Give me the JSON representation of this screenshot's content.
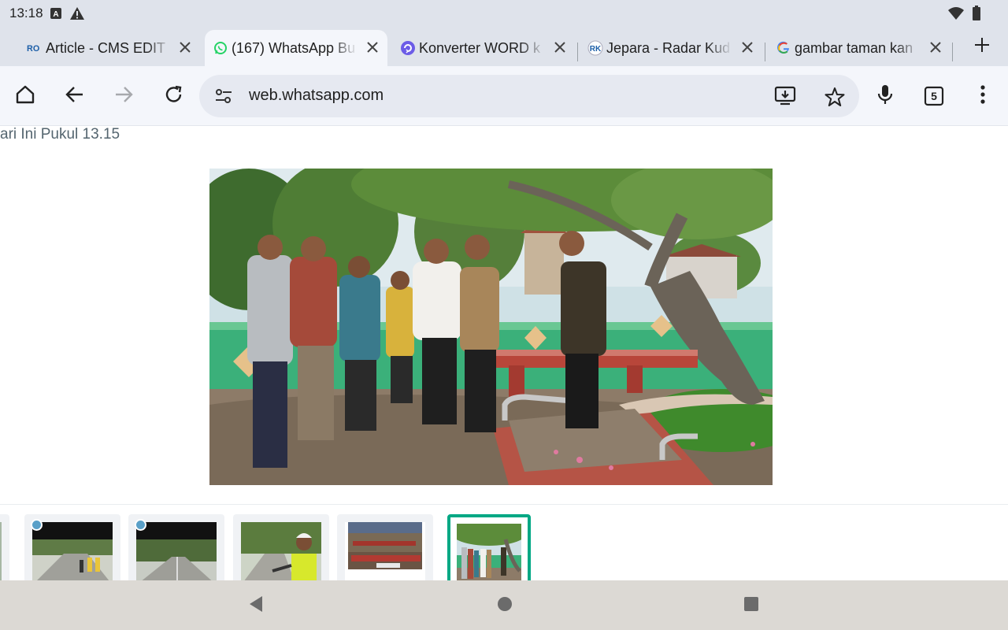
{
  "status": {
    "time": "13:18",
    "left_icons": [
      "a-icon",
      "warning-icon"
    ],
    "right_icons": [
      "wifi-icon",
      "battery-icon"
    ]
  },
  "tabs": [
    {
      "title": "Article - CMS EDIT",
      "favicon": "ro-logo-icon",
      "active": false
    },
    {
      "title": "(167) WhatsApp Bu",
      "favicon": "whatsapp-icon",
      "active": true
    },
    {
      "title": "Konverter WORD k",
      "favicon": "converter-icon",
      "active": false
    },
    {
      "title": "Jepara - Radar Kud",
      "favicon": "radar-kudus-icon",
      "active": false
    },
    {
      "title": "gambar taman kan",
      "favicon": "google-icon",
      "active": false
    }
  ],
  "toolbar": {
    "url": "web.whatsapp.com",
    "tab_count": "5"
  },
  "content": {
    "caption": "ari Ini Pukul 13.15",
    "main_photo_alt": "",
    "thumbnails": [
      {
        "kind": "video",
        "selected": false
      },
      {
        "kind": "video",
        "selected": false
      },
      {
        "kind": "photo",
        "selected": false
      },
      {
        "kind": "document",
        "selected": false
      },
      {
        "kind": "photo",
        "selected": true
      }
    ]
  },
  "colors": {
    "accent": "#00a884",
    "chrome_bg": "#dfe3eb",
    "toolbar_bg": "#f4f6fb",
    "nav_bg": "#dcd9d4"
  }
}
